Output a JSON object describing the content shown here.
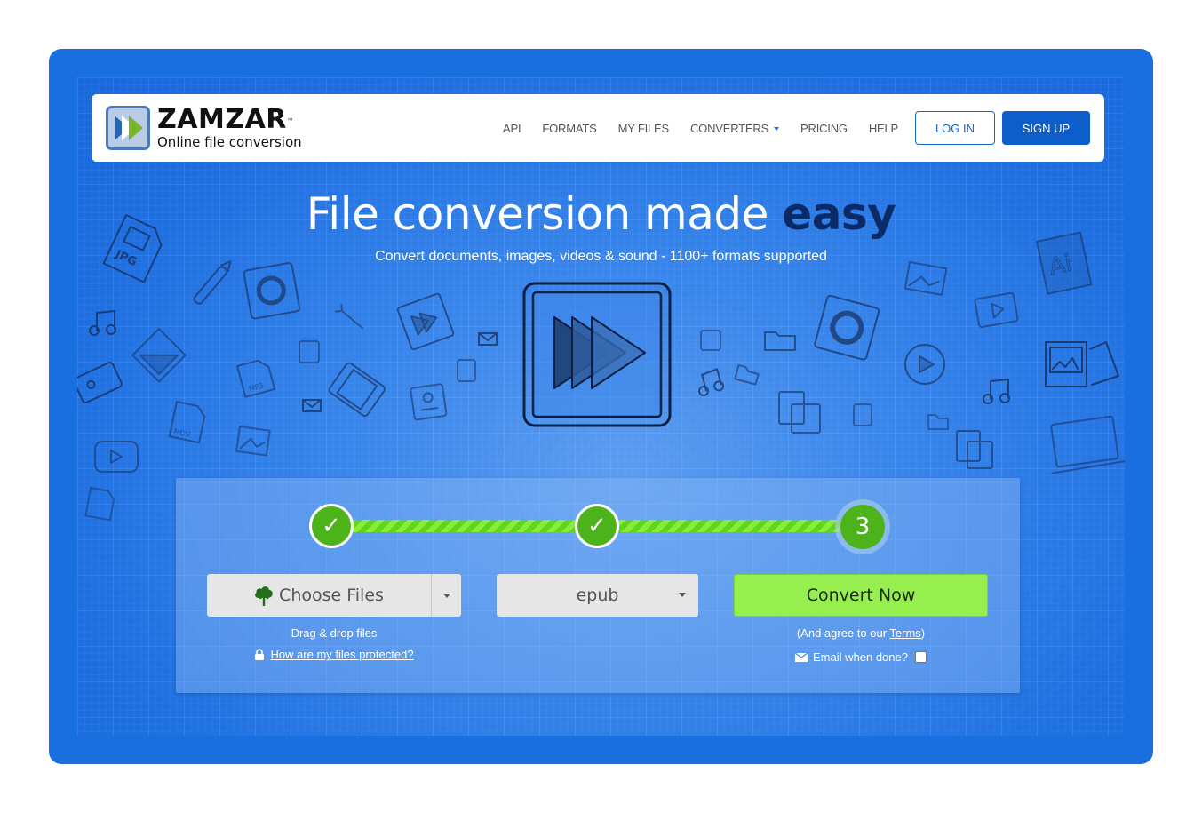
{
  "brand": {
    "name": "ZAMZAR",
    "trademark": "™",
    "tagline": "Online file conversion",
    "colors": {
      "primary": "#1a6fe0",
      "accent_green": "#96ef4f",
      "step_green": "#4db31b",
      "headline_dark": "#0b2a66"
    }
  },
  "nav": {
    "links": [
      {
        "label": "API"
      },
      {
        "label": "FORMATS"
      },
      {
        "label": "MY FILES"
      },
      {
        "label": "CONVERTERS",
        "has_dropdown": true
      },
      {
        "label": "PRICING"
      },
      {
        "label": "HELP"
      }
    ],
    "login_label": "LOG IN",
    "signup_label": "SIGN UP"
  },
  "hero": {
    "headline_regular": "File conversion made ",
    "headline_strong": "easy",
    "subheadline": "Convert documents, images, videos & sound - 1100+ formats supported",
    "doodle_icons": [
      "jpg-file-icon",
      "pencil-icon",
      "music-note-icon",
      "refresh-icon",
      "wrench-icon",
      "fast-forward-icon",
      "envelope-icon",
      "film-strip-icon",
      "mp3-file-icon",
      "mov-file-icon",
      "image-icon",
      "video-play-icon",
      "folder-icon",
      "clipboard-icon",
      "play-circle-icon",
      "ai-file-icon",
      "photo-frame-icon",
      "laptop-icon",
      "cassette-icon"
    ]
  },
  "converter": {
    "steps": [
      {
        "label": "✓",
        "state": "complete"
      },
      {
        "label": "✓",
        "state": "complete"
      },
      {
        "label": "3",
        "state": "current"
      }
    ],
    "choose_files_label": "Choose Files",
    "drag_drop_text": "Drag & drop files",
    "protection_link": "How are my files protected?",
    "format_selected": "epub",
    "convert_label": "Convert Now",
    "terms_prefix": "(And agree to our ",
    "terms_link": "Terms",
    "terms_suffix": ")",
    "email_label": "Email when done?",
    "email_checked": false
  }
}
